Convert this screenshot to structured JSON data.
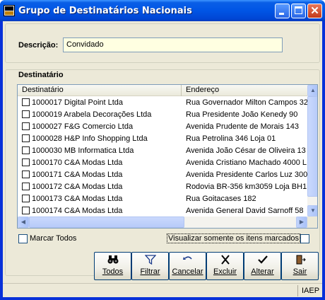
{
  "window": {
    "title": "Grupo de Destinatários Nacionais",
    "minimize_glyph": "–",
    "maximize_glyph": "□",
    "close_glyph": "✕"
  },
  "descricao": {
    "label": "Descrição:",
    "value": "Convidado"
  },
  "destinatario_group": {
    "title": "Destinatário",
    "columns": [
      "Destinatário",
      "Endereço"
    ],
    "rows": [
      {
        "destinatario": "1000017 Digital Point Ltda",
        "endereco": "Rua Governador Milton Campos 32",
        "checked": false
      },
      {
        "destinatario": "1000019 Arabela Decorações Ltda",
        "endereco": "Rua Presidente João Kenedy 90",
        "checked": false
      },
      {
        "destinatario": "1000027 F&G Comercio Ltda",
        "endereco": "Avenida Prudente de Morais 143",
        "checked": false
      },
      {
        "destinatario": "1000028 H&P Info Shopping Ltda",
        "endereco": "Rua Petrolina 346 Loja 01",
        "checked": false
      },
      {
        "destinatario": "1000030 MB Informatica Ltda",
        "endereco": "Avenida João César de Oliveira 13",
        "checked": false
      },
      {
        "destinatario": "1000170 C&A Modas Ltda",
        "endereco": "Avenida Cristiano Machado 4000 L",
        "checked": false
      },
      {
        "destinatario": "1000171 C&A Modas Ltda",
        "endereco": "Avenida Presidente Carlos Luz 300",
        "checked": false
      },
      {
        "destinatario": "1000172 C&A Modas Ltda",
        "endereco": "Rodovia BR-356 km3059 Loja BH1",
        "checked": false
      },
      {
        "destinatario": "1000173 C&A Modas Ltda",
        "endereco": "Rua Goitacases 182",
        "checked": false
      },
      {
        "destinatario": "1000174 C&A Modas Ltda",
        "endereco": "Avenida General David Sarnoff 58",
        "checked": false
      }
    ],
    "scroll": {
      "up_glyph": "▲",
      "down_glyph": "▼",
      "left_glyph": "◀",
      "right_glyph": "▶"
    }
  },
  "marcar_todos": {
    "label": "Marcar Todos",
    "checked": false
  },
  "visualizar": {
    "label": "Visualizar somente os itens marcados",
    "checked": false
  },
  "toolbar": {
    "buttons": [
      {
        "label": "Todos",
        "icon": "binoculars-icon",
        "glyph": "👓"
      },
      {
        "label": "Filtrar",
        "icon": "filter-icon",
        "glyph": "▽"
      },
      {
        "label": "Cancelar",
        "icon": "undo-icon",
        "glyph": "↶"
      },
      {
        "label": "Excluir",
        "icon": "delete-x-icon",
        "glyph": "✕"
      },
      {
        "label": "Alterar",
        "icon": "checkmark-icon",
        "glyph": "✔"
      },
      {
        "label": "Sair",
        "icon": "exit-door-icon",
        "glyph": "🚪"
      }
    ]
  },
  "statusbar": {
    "text": "IAEP"
  }
}
